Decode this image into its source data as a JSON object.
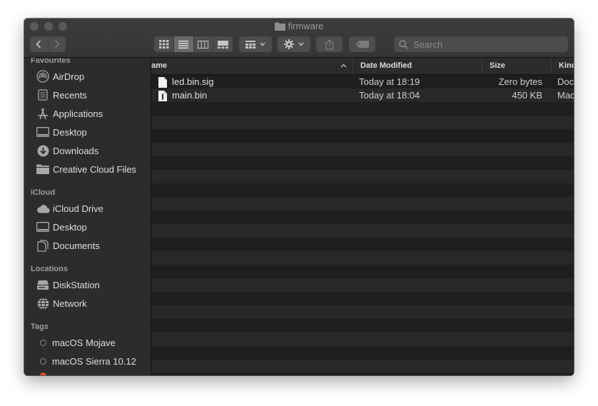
{
  "window": {
    "title": "firmware"
  },
  "toolbar": {
    "back_icon": "chevron-left-icon",
    "forward_icon": "chevron-right-icon",
    "view_modes": [
      "icon-view-icon",
      "list-view-icon",
      "column-view-icon",
      "gallery-view-icon"
    ],
    "active_view": "list-view-icon",
    "group_icon": "group-by-icon",
    "action_icon": "gear-icon",
    "share_icon": "share-icon",
    "tag_icon": "tag-icon",
    "search_placeholder": "Search"
  },
  "sidebar": {
    "favourites_header": "Favourites",
    "favourites": [
      {
        "label": "AirDrop",
        "icon": "airdrop-icon"
      },
      {
        "label": "Recents",
        "icon": "recents-icon"
      },
      {
        "label": "Applications",
        "icon": "applications-icon"
      },
      {
        "label": "Desktop",
        "icon": "desktop-icon"
      },
      {
        "label": "Downloads",
        "icon": "downloads-icon"
      },
      {
        "label": "Creative Cloud Files",
        "icon": "folder-icon"
      }
    ],
    "icloud_header": "iCloud",
    "icloud": [
      {
        "label": "iCloud Drive",
        "icon": "cloud-icon"
      },
      {
        "label": "Desktop",
        "icon": "desktop-icon"
      },
      {
        "label": "Documents",
        "icon": "documents-icon"
      }
    ],
    "locations_header": "Locations",
    "locations": [
      {
        "label": "DiskStation",
        "icon": "server-icon"
      },
      {
        "label": "Network",
        "icon": "network-icon"
      }
    ],
    "tags_header": "Tags",
    "tags": [
      {
        "label": "macOS Mojave"
      },
      {
        "label": "macOS Sierra 10.12"
      }
    ]
  },
  "list": {
    "columns": {
      "name": "ame",
      "date": "Date Modified",
      "size": "Size",
      "kind": "Kinc"
    },
    "rows": [
      {
        "name": "led.bin.sig",
        "date": "Today at 18:19",
        "size": "Zero bytes",
        "kind": "Doc"
      },
      {
        "name": "main.bin",
        "date": "Today at 18:04",
        "size": "450 KB",
        "kind": "Mac"
      }
    ]
  },
  "colors": {
    "background": "#1e1e1e",
    "sidebar": "#2c2c2c",
    "row_alt": "#282828",
    "toolbar": "#3a3a3a"
  }
}
